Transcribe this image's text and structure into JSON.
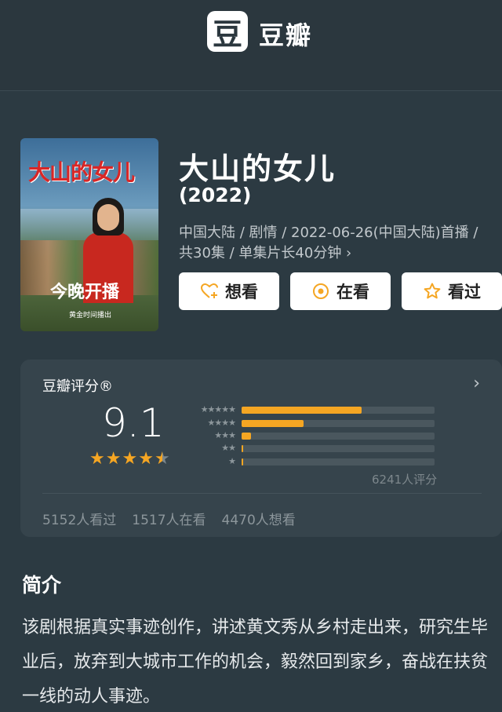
{
  "header": {
    "logo_char": "豆",
    "brand": "豆瓣"
  },
  "poster": {
    "title": "大山的女儿",
    "tagline": "今晚开播",
    "time_text": "黄金时间播出"
  },
  "movie": {
    "title": "大山的女儿",
    "year": "(2022)",
    "meta_line1": "中国大陆 / 剧情 / 2022-06-26(中国大陆)首播 /",
    "meta_line2": "共30集 / 单集片长40分钟 ›"
  },
  "actions": [
    {
      "label": "想看",
      "icon": "heart-plus-icon"
    },
    {
      "label": "在看",
      "icon": "target-icon"
    },
    {
      "label": "看过",
      "icon": "star-outline-icon"
    }
  ],
  "rating": {
    "title": "豆瓣评分®",
    "score": "9.1",
    "stars": 4.5,
    "distribution": [
      {
        "stars": 5,
        "fraction": 0.62
      },
      {
        "stars": 4,
        "fraction": 0.32
      },
      {
        "stars": 3,
        "fraction": 0.05
      },
      {
        "stars": 2,
        "fraction": 0.01
      },
      {
        "stars": 1,
        "fraction": 0.01
      }
    ],
    "count_text": "6241人评分",
    "watched": "5152人看过",
    "watching": "1517人在看",
    "want": "4470人想看"
  },
  "intro": {
    "heading": "简介",
    "text": "该剧根据真实事迹创作，讲述黄文秀从乡村走出来，研究生毕业后，放弃到大城市工作的机会，毅然回到家乡，奋战在扶贫一线的动人事迹。"
  },
  "colors": {
    "accent": "#f5a623",
    "background": "#2c3a42",
    "card": "#36444c"
  }
}
